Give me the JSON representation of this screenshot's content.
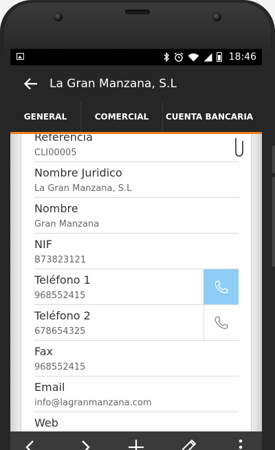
{
  "status_bar": {
    "time": "18:46"
  },
  "app_bar": {
    "title": "La Gran Manzana, S.L"
  },
  "tabs": [
    {
      "label": "GENERAL",
      "active": true
    },
    {
      "label": "COMERCIAL",
      "active": false
    },
    {
      "label": "CUENTA BANCARIA",
      "active": false
    }
  ],
  "fields": {
    "referencia": {
      "label": "Referencia",
      "value": "CLI00005"
    },
    "nombre_juridico": {
      "label": "Nombre Juridico",
      "value": "La Gran Manzana, S.L"
    },
    "nombre": {
      "label": "Nombre",
      "value": "Gran Manzana"
    },
    "nif": {
      "label": "NIF",
      "value": "B73823121"
    },
    "telefono1": {
      "label": "Teléfono 1",
      "value": "968552415"
    },
    "telefono2": {
      "label": "Teléfono 2",
      "value": "678654325"
    },
    "fax": {
      "label": "Fax",
      "value": "968552415"
    },
    "email": {
      "label": "Email",
      "value": "info@lagranmanzana.com"
    },
    "web": {
      "label": "Web",
      "value": ""
    }
  },
  "colors": {
    "accent": "#f07b1a",
    "call_active": "#8ecdf5",
    "bar": "#262626"
  },
  "icons": [
    "image-icon",
    "bluetooth-icon",
    "alarm-icon",
    "wifi-icon",
    "signal-icon",
    "battery-icon",
    "back-arrow-icon",
    "attachment-icon",
    "phone-icon",
    "chevron-left-icon",
    "chevron-right-icon",
    "add-icon",
    "edit-icon",
    "more-icon"
  ]
}
